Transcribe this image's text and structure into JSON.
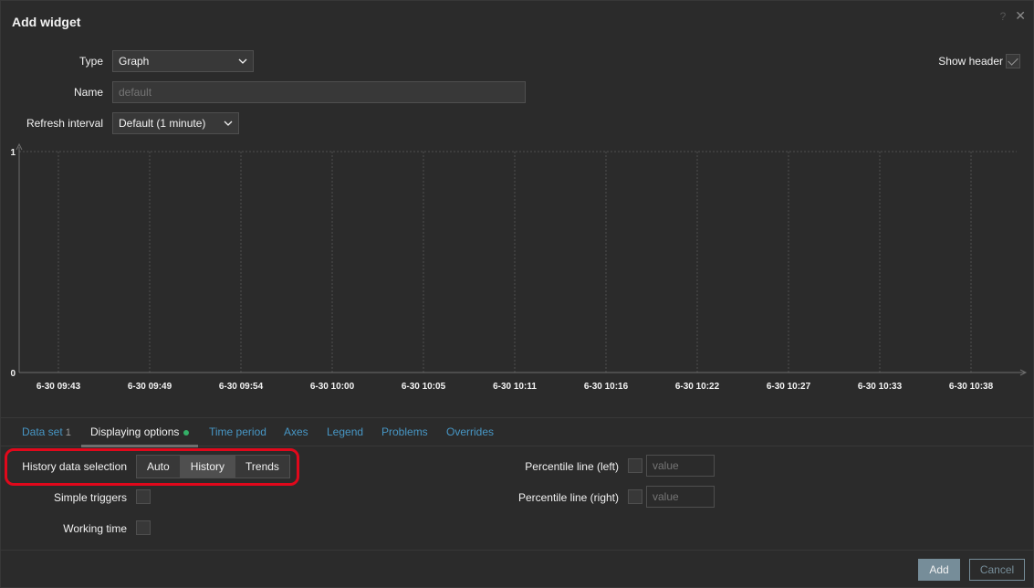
{
  "dialog": {
    "title": "Add widget",
    "help_icon": "?",
    "close_icon": "✕"
  },
  "form": {
    "type_label": "Type",
    "type_value": "Graph",
    "name_label": "Name",
    "name_placeholder": "default",
    "refresh_label": "Refresh interval",
    "refresh_value": "Default (1 minute)",
    "show_header_label": "Show header",
    "show_header_checked": true
  },
  "chart_data": {
    "type": "line",
    "title": "",
    "xlabel": "",
    "ylabel": "",
    "ylim": [
      0,
      1
    ],
    "y_ticks": [
      "1",
      "0"
    ],
    "categories": [
      "6-30 09:43",
      "6-30 09:49",
      "6-30 09:54",
      "6-30 10:00",
      "6-30 10:05",
      "6-30 10:11",
      "6-30 10:16",
      "6-30 10:22",
      "6-30 10:27",
      "6-30 10:33",
      "6-30 10:38"
    ],
    "series": [],
    "grid": true
  },
  "tabs": [
    {
      "label": "Data set",
      "count": "1"
    },
    {
      "label": "Displaying options",
      "active": true
    },
    {
      "label": "Time period"
    },
    {
      "label": "Axes"
    },
    {
      "label": "Legend"
    },
    {
      "label": "Problems"
    },
    {
      "label": "Overrides"
    }
  ],
  "options": {
    "history_label": "History data selection",
    "history_choices": [
      "Auto",
      "History",
      "Trends"
    ],
    "history_selected": "History",
    "simple_triggers_label": "Simple triggers",
    "working_time_label": "Working time",
    "percentile_left_label": "Percentile line (left)",
    "percentile_right_label": "Percentile line (right)",
    "percentile_placeholder": "value"
  },
  "footer": {
    "add_label": "Add",
    "cancel_label": "Cancel"
  },
  "colors": {
    "background": "#2b2b2b",
    "link": "#4796c4",
    "primary_button": "#768d99",
    "highlight": "#e0081b"
  }
}
